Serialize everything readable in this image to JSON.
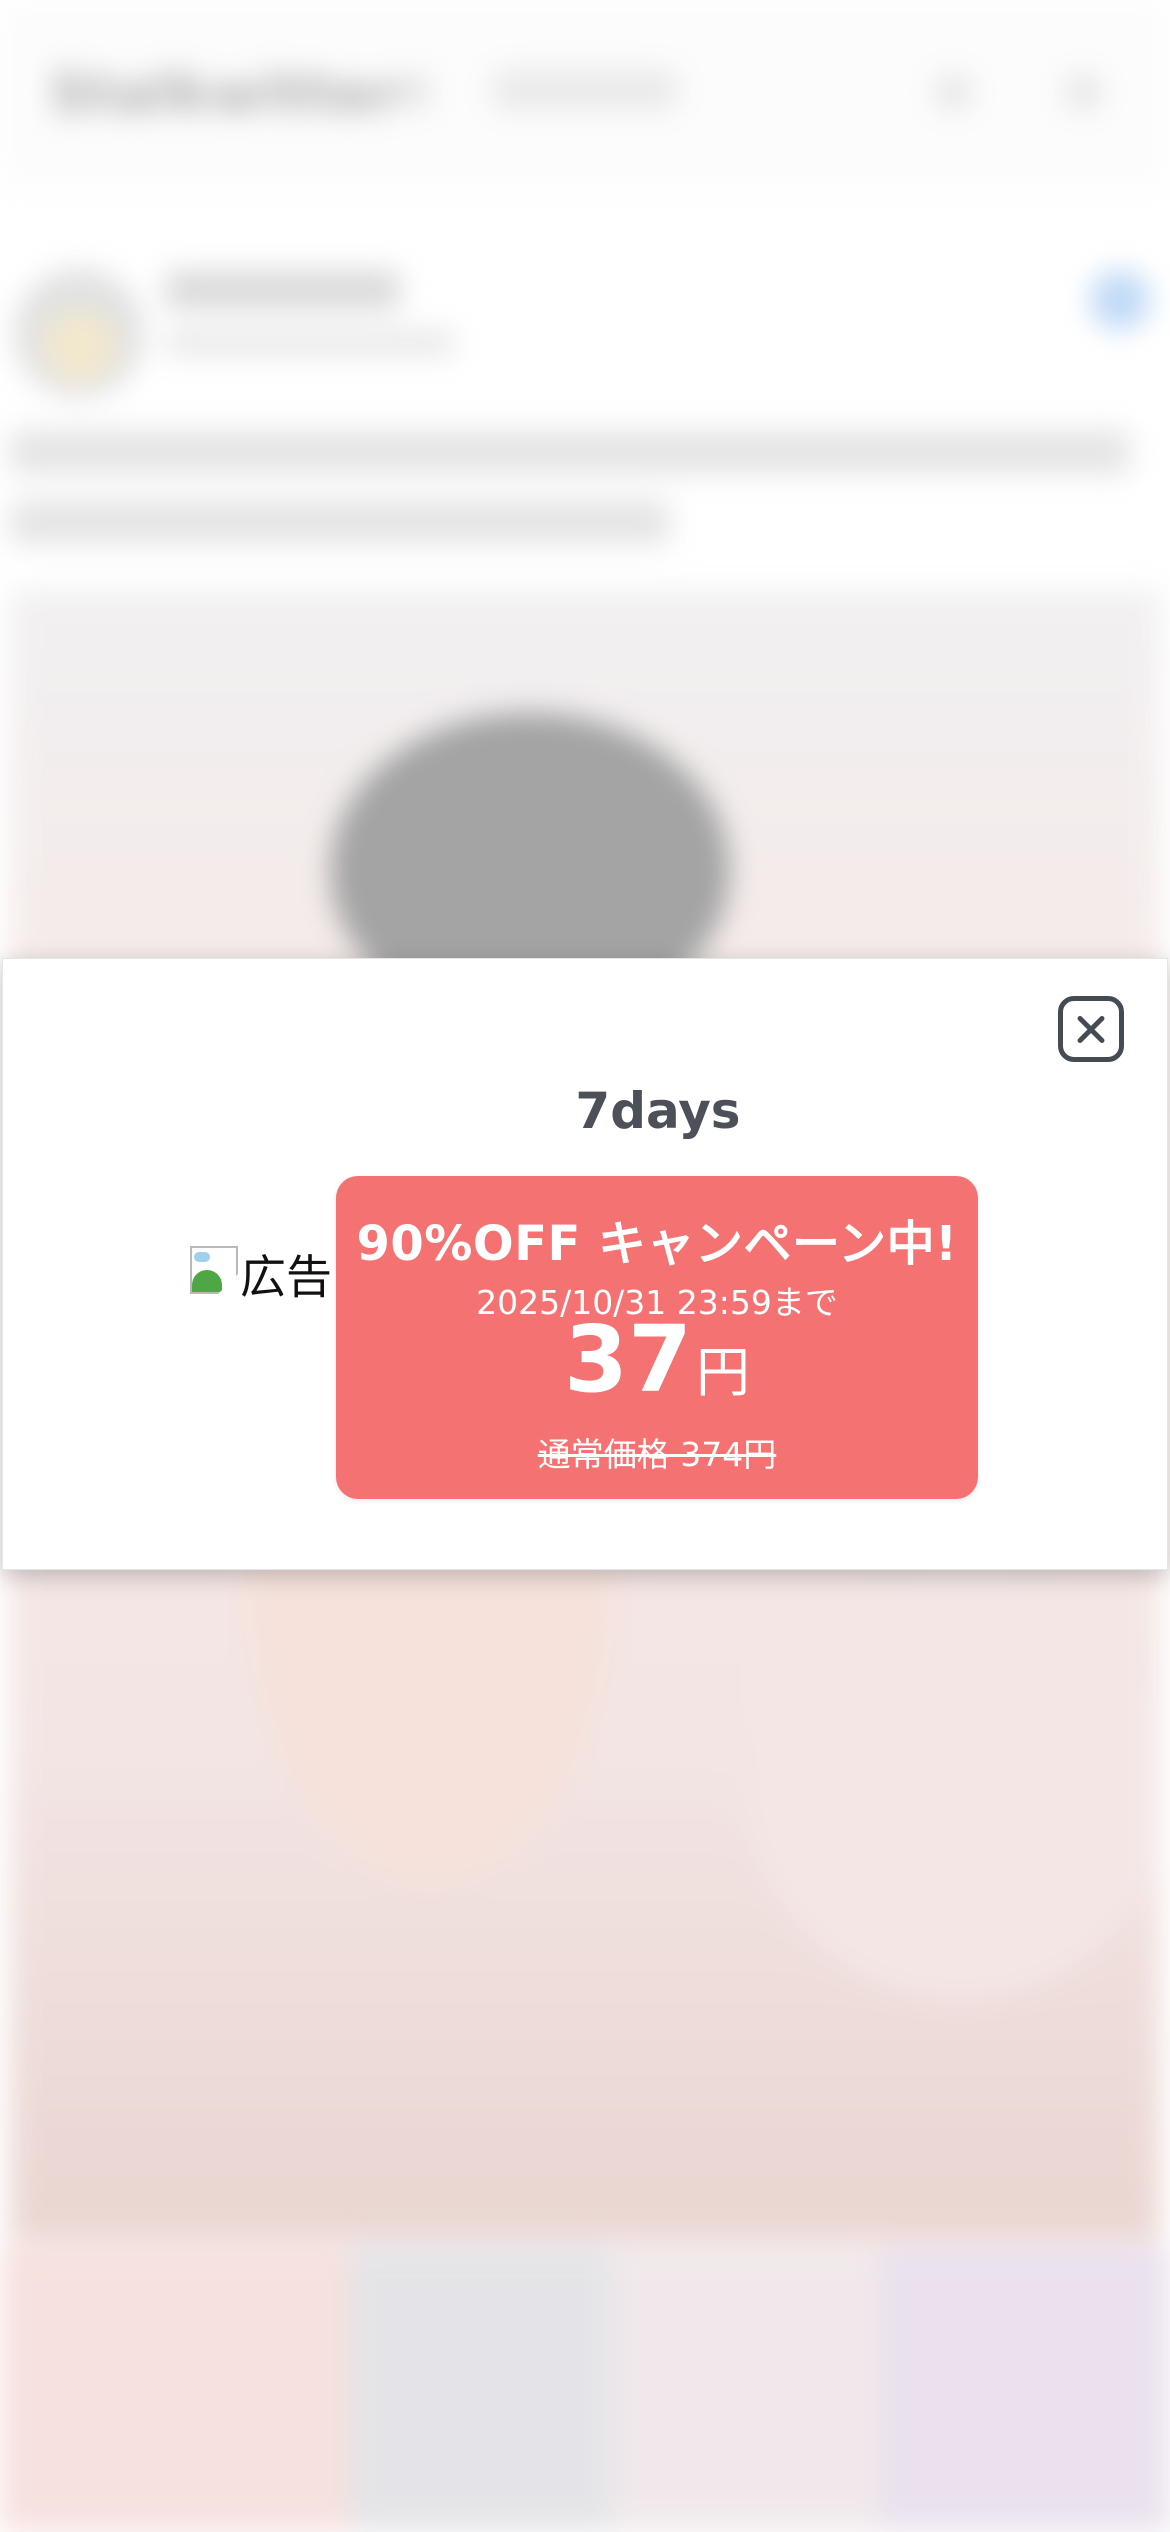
{
  "header": {
    "logo_text": "Stalkwitter"
  },
  "modal": {
    "title": "7days",
    "ad_image_alt": "広告",
    "promo": {
      "headline": "90%OFF キャンペーン中!",
      "deadline": "2025/10/31 23:59まで",
      "price_value": "37",
      "price_unit": "円",
      "regular_price": "通常価格 374円"
    }
  },
  "icons": {
    "close": "close-icon",
    "broken_image": "broken-image-icon",
    "verified": "verified-badge-icon"
  },
  "colors": {
    "promo_background": "#f47272",
    "title_text": "#4b5059",
    "close_stroke": "#444b53"
  }
}
